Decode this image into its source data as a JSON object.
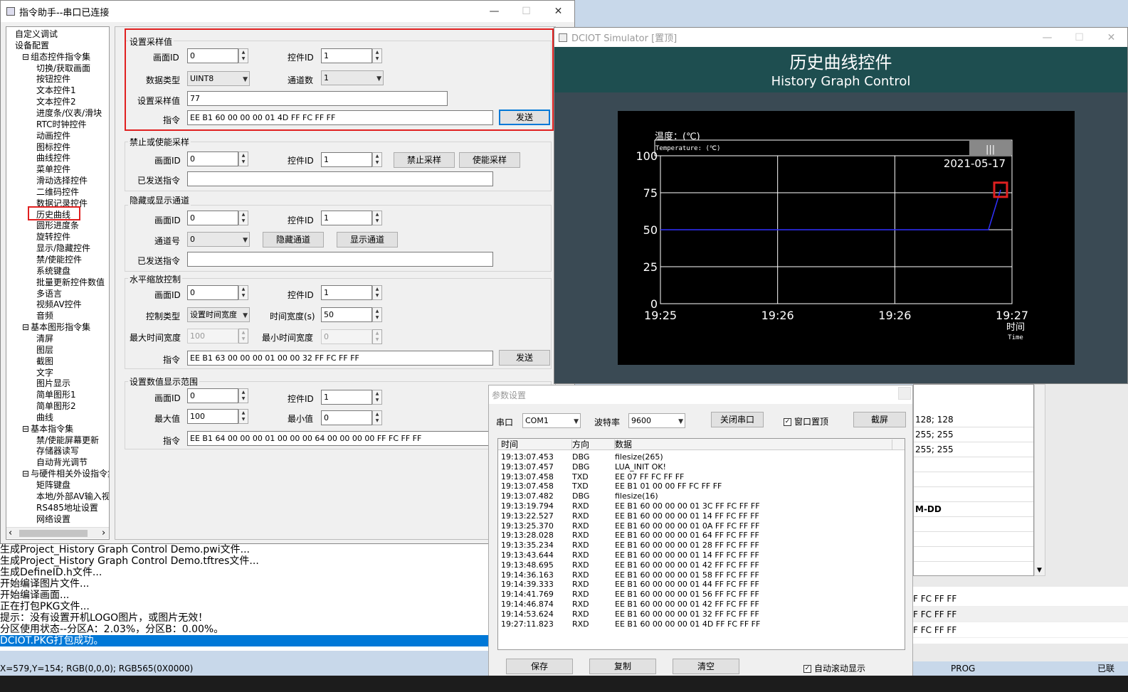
{
  "main_window": {
    "title": "指令助手--串口已连接",
    "min": "—",
    "max": "☐",
    "close": "✕"
  },
  "tree": {
    "items": [
      {
        "label": "自定义调试",
        "level": 1
      },
      {
        "label": "设备配置",
        "level": 1
      },
      {
        "label": "组态控件指令集",
        "level": 0,
        "toggle": "⊟"
      },
      {
        "label": "切换/获取画面",
        "level": 2
      },
      {
        "label": "按钮控件",
        "level": 2
      },
      {
        "label": "文本控件1",
        "level": 2
      },
      {
        "label": "文本控件2",
        "level": 2
      },
      {
        "label": "进度条/仪表/滑块",
        "level": 2
      },
      {
        "label": "RTC时钟控件",
        "level": 2
      },
      {
        "label": "动画控件",
        "level": 2
      },
      {
        "label": "图标控件",
        "level": 2
      },
      {
        "label": "曲线控件",
        "level": 2
      },
      {
        "label": "菜单控件",
        "level": 2
      },
      {
        "label": "滑动选择控件",
        "level": 2
      },
      {
        "label": "二维码控件",
        "level": 2
      },
      {
        "label": "数据记录控件",
        "level": 2
      },
      {
        "label": "历史曲线",
        "level": 2
      },
      {
        "label": "圆形进度条",
        "level": 2
      },
      {
        "label": "旋转控件",
        "level": 2
      },
      {
        "label": "显示/隐藏控件",
        "level": 2
      },
      {
        "label": "禁/使能控件",
        "level": 2
      },
      {
        "label": "系统键盘",
        "level": 2
      },
      {
        "label": "批量更新控件数值",
        "level": 2
      },
      {
        "label": "多语言",
        "level": 2
      },
      {
        "label": "视频AV控件",
        "level": 2
      },
      {
        "label": "音频",
        "level": 2
      },
      {
        "label": "基本图形指令集",
        "level": 0,
        "toggle": "⊟"
      },
      {
        "label": "清屏",
        "level": 2
      },
      {
        "label": "图层",
        "level": 2
      },
      {
        "label": "截图",
        "level": 2
      },
      {
        "label": "文字",
        "level": 2
      },
      {
        "label": "图片显示",
        "level": 2
      },
      {
        "label": "简单图形1",
        "level": 2
      },
      {
        "label": "简单图形2",
        "level": 2
      },
      {
        "label": "曲线",
        "level": 2
      },
      {
        "label": "基本指令集",
        "level": 0,
        "toggle": "⊟"
      },
      {
        "label": "禁/使能屏幕更新",
        "level": 2
      },
      {
        "label": "存储器读写",
        "level": 2
      },
      {
        "label": "自动背光调节",
        "level": 2
      },
      {
        "label": "与硬件相关外设指令集",
        "level": 0,
        "toggle": "⊟"
      },
      {
        "label": "矩阵键盘",
        "level": 2
      },
      {
        "label": "本地/外部AV输入视频",
        "level": 2
      },
      {
        "label": "RS485地址设置",
        "level": 2
      },
      {
        "label": "网络设置",
        "level": 2
      }
    ],
    "scroll_left": "‹",
    "scroll_right": "›"
  },
  "g1": {
    "title": "设置采样值",
    "screen_label": "画面ID",
    "screen_val": "0",
    "ctrl_label": "控件ID",
    "ctrl_val": "1",
    "dtype_label": "数据类型",
    "dtype_val": "UINT8",
    "ch_label": "通道数",
    "ch_val": "1",
    "sample_label": "设置采样值",
    "sample_val": "77",
    "cmd_label": "指令",
    "cmd_val": "EE B1 60 00 00 00 01 4D FF FC FF FF",
    "send": "发送"
  },
  "g2": {
    "title": "禁止或使能采样",
    "screen_label": "画面ID",
    "screen_val": "0",
    "ctrl_label": "控件ID",
    "ctrl_val": "1",
    "disable": "禁止采样",
    "enable": "使能采样",
    "sent_label": "已发送指令",
    "sent_val": ""
  },
  "g3": {
    "title": "隐藏或显示通道",
    "screen_label": "画面ID",
    "screen_val": "0",
    "ctrl_label": "控件ID",
    "ctrl_val": "1",
    "ch_label": "通道号",
    "ch_val": "0",
    "hide": "隐藏通道",
    "show": "显示通道",
    "sent_label": "已发送指令",
    "sent_val": ""
  },
  "g4": {
    "title": "水平缩放控制",
    "screen_label": "画面ID",
    "screen_val": "0",
    "ctrl_label": "控件ID",
    "ctrl_val": "1",
    "type_label": "控制类型",
    "type_val": "设置时间宽度",
    "width_label": "时间宽度(s)",
    "width_val": "50",
    "max_label": "最大时间宽度",
    "max_val": "100",
    "min_label": "最小时间宽度",
    "min_val": "0",
    "cmd_label": "指令",
    "cmd_val": "EE B1 63 00 00 00 01 00 00 32 FF FC FF FF",
    "send": "发送"
  },
  "g5": {
    "title": "设置数值显示范围",
    "screen_label": "画面ID",
    "screen_val": "0",
    "ctrl_label": "控件ID",
    "ctrl_val": "1",
    "max_label": "最大值",
    "max_val": "100",
    "min_label": "最小值",
    "min_val": "0",
    "cmd_label": "指令",
    "cmd_val": "EE B1 64 00 00 00 01 00 00 00 64 00 00 00 00 FF FC FF FF"
  },
  "log": {
    "lines": [
      "生成Project_History Graph Control Demo.pwi文件...",
      "生成Project_History Graph Control Demo.tftres文件...",
      "生成DefineID.h文件...",
      "开始编译图片文件...",
      "开始编译画面...",
      "正在打包PKG文件...",
      "提示：没有设置开机LOGO图片，或图片无效！",
      "分区使用状态--分区A：2.03%，分区B：0.00%。",
      "DCIOT.PKG打包成功。"
    ]
  },
  "status": {
    "left": "X=579,Y=154; RGB(0,0,0); RGB565(0X0000)",
    "prog": "PROG",
    "right": "已联"
  },
  "sim": {
    "title": "DCIOT Simulator [置顶]",
    "min": "—",
    "max": "☐",
    "close": "✕",
    "header_cn": "历史曲线控件",
    "header_en": "History Graph Control"
  },
  "chart_data": {
    "type": "line",
    "title": "温度：(℃)",
    "subtitle": "Temperature: (℃)",
    "scroll_glyph": "|||",
    "date": "2021-05-17",
    "xlabel": "时间",
    "xlabel_en": "Time",
    "x_ticks": [
      "19:25",
      "19:26",
      "19:26",
      "19:27"
    ],
    "y_ticks": [
      "100",
      "75",
      "50",
      "25",
      "0"
    ],
    "ylim": [
      0,
      100
    ],
    "series": [
      {
        "values": [
          50,
          50,
          50,
          50,
          50,
          50,
          50,
          50,
          50,
          50,
          50,
          50,
          50,
          50,
          50,
          50,
          50,
          50,
          50,
          50,
          50,
          50,
          50,
          50,
          50,
          50,
          50,
          50,
          77
        ]
      }
    ],
    "grid": true,
    "colors": {
      "grid": "#ffffff",
      "series": "#3030ff",
      "marker": "#e02020"
    }
  },
  "param": {
    "title": "参数设置",
    "port_label": "串口",
    "port_val": "COM1",
    "baud_label": "波特率",
    "baud_val": "9600",
    "close_port": "关闭串口",
    "topmost": "窗口置顶",
    "screenshot": "截屏",
    "headers": [
      "时间",
      "方向",
      "数据"
    ],
    "rows": [
      [
        "19:13:07.453",
        "DBG",
        "filesize(265)"
      ],
      [
        "19:13:07.457",
        "DBG",
        "LUA_INIT OK!"
      ],
      [
        "19:13:07.458",
        "TXD",
        "EE 07 FF FC FF FF"
      ],
      [
        "19:13:07.458",
        "TXD",
        "EE B1 01 00 00 FF FC FF FF"
      ],
      [
        "19:13:07.482",
        "DBG",
        "filesize(16)"
      ],
      [
        "19:13:19.794",
        "RXD",
        "EE B1 60 00 00 00 01 3C FF FC FF FF"
      ],
      [
        "19:13:22.527",
        "RXD",
        "EE B1 60 00 00 00 01 14 FF FC FF FF"
      ],
      [
        "19:13:25.370",
        "RXD",
        "EE B1 60 00 00 00 01 0A FF FC FF FF"
      ],
      [
        "19:13:28.028",
        "RXD",
        "EE B1 60 00 00 00 01 64 FF FC FF FF"
      ],
      [
        "19:13:35.234",
        "RXD",
        "EE B1 60 00 00 00 01 28 FF FC FF FF"
      ],
      [
        "19:13:43.644",
        "RXD",
        "EE B1 60 00 00 00 01 14 FF FC FF FF"
      ],
      [
        "19:13:48.695",
        "RXD",
        "EE B1 60 00 00 00 01 42 FF FC FF FF"
      ],
      [
        "19:14:36.163",
        "RXD",
        "EE B1 60 00 00 00 01 58 FF FC FF FF"
      ],
      [
        "19:14:39.333",
        "RXD",
        "EE B1 60 00 00 00 01 44 FF FC FF FF"
      ],
      [
        "19:14:41.769",
        "RXD",
        "EE B1 60 00 00 00 01 56 FF FC FF FF"
      ],
      [
        "19:14:46.874",
        "RXD",
        "EE B1 60 00 00 00 01 42 FF FC FF FF"
      ],
      [
        "19:14:53.624",
        "RXD",
        "EE B1 60 00 00 00 01 32 FF FC FF FF"
      ],
      [
        "19:27:11.823",
        "RXD",
        "EE B1 60 00 00 00 01 4D FF FC FF FF"
      ]
    ],
    "save": "保存",
    "copy": "复制",
    "clear": "清空",
    "autoscroll": "自动滚动显示"
  },
  "right_panel": {
    "rows": [
      "128; 128",
      "255; 255",
      "255; 255",
      "",
      "",
      "",
      "M-DD",
      "",
      "",
      ""
    ],
    "lower": [
      "F FC FF FF",
      "F FC FF FF",
      "F FC FF FF"
    ]
  }
}
